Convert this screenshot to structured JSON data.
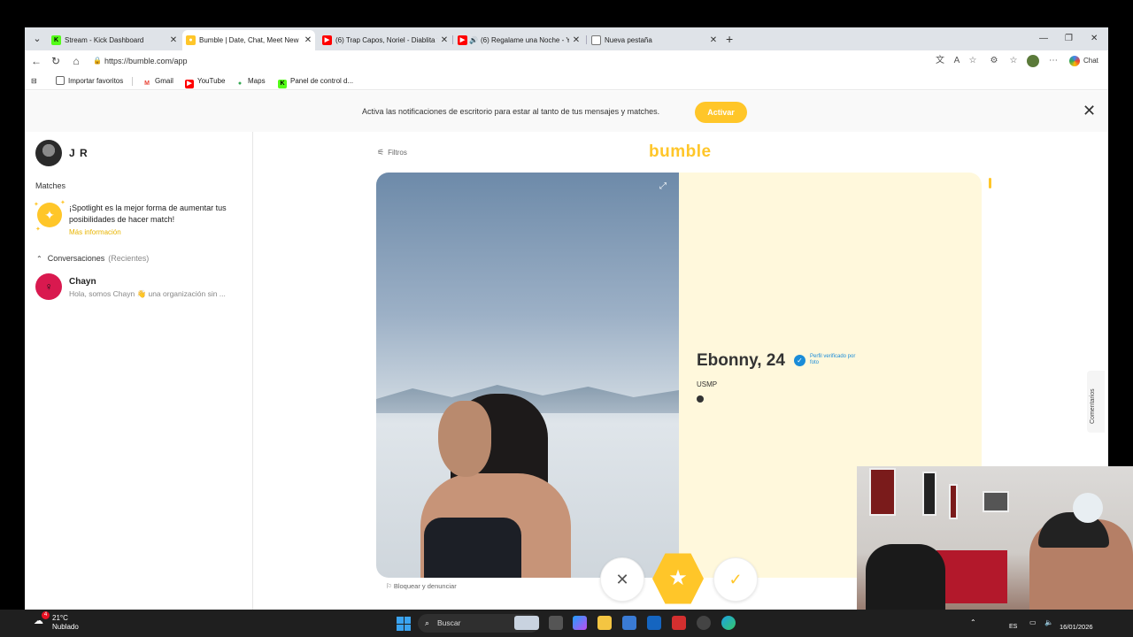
{
  "tabs": [
    {
      "title": "Stream - Kick Dashboard",
      "favicon": "kick-icon"
    },
    {
      "title": "Bumble | Date, Chat, Meet New Pe",
      "favicon": "bumble-icon"
    },
    {
      "title": "(6) Trap Capos, Noriel - Diablita ft.",
      "favicon": "youtube-icon"
    },
    {
      "title": "(6) Regalame una Noche - Yo",
      "favicon": "youtube-icon"
    },
    {
      "title": "Nueva pestaña",
      "favicon": "page-icon"
    }
  ],
  "address": {
    "url": "https://bumble.com/app"
  },
  "toolbar": {
    "chat_label": "Chat"
  },
  "bookmarks": [
    {
      "label": "Importar favoritos"
    },
    {
      "label": "Gmail"
    },
    {
      "label": "YouTube"
    },
    {
      "label": "Maps"
    },
    {
      "label": "Panel de control d..."
    }
  ],
  "notification": {
    "text": "Activa las notificaciones de escritorio para estar al tanto de tus mensajes y matches.",
    "button": "Activar"
  },
  "sidebar": {
    "user_name": "J R",
    "matches_heading": "Matches",
    "spotlight_text": "¡Spotlight es la mejor forma de aumentar tus posibilidades de hacer match!",
    "spotlight_link": "Más información",
    "conversations_heading": "Conversaciones",
    "conversations_filter": "(Recientes)",
    "conversations": [
      {
        "name": "Chayn",
        "preview": "Hola, somos Chayn 👋 una organización sin ..."
      }
    ]
  },
  "main": {
    "filters_label": "Filtros",
    "logo": "bumble",
    "profile": {
      "name_age": "Ebonny, 24",
      "verified_text": "Perfil verificado por foto",
      "school": "USMP"
    },
    "block_label": "Bloquear y denunciar",
    "comments_label": "Comentarios"
  },
  "taskbar": {
    "temperature": "21°C",
    "weather": "Nublado",
    "weather_badge": "4",
    "search_placeholder": "Buscar",
    "language": "ES",
    "date": "16/01/2026"
  },
  "colors": {
    "accent": "#ffc629",
    "card_bg": "#fff8dc",
    "verified": "#1a8cd8"
  }
}
